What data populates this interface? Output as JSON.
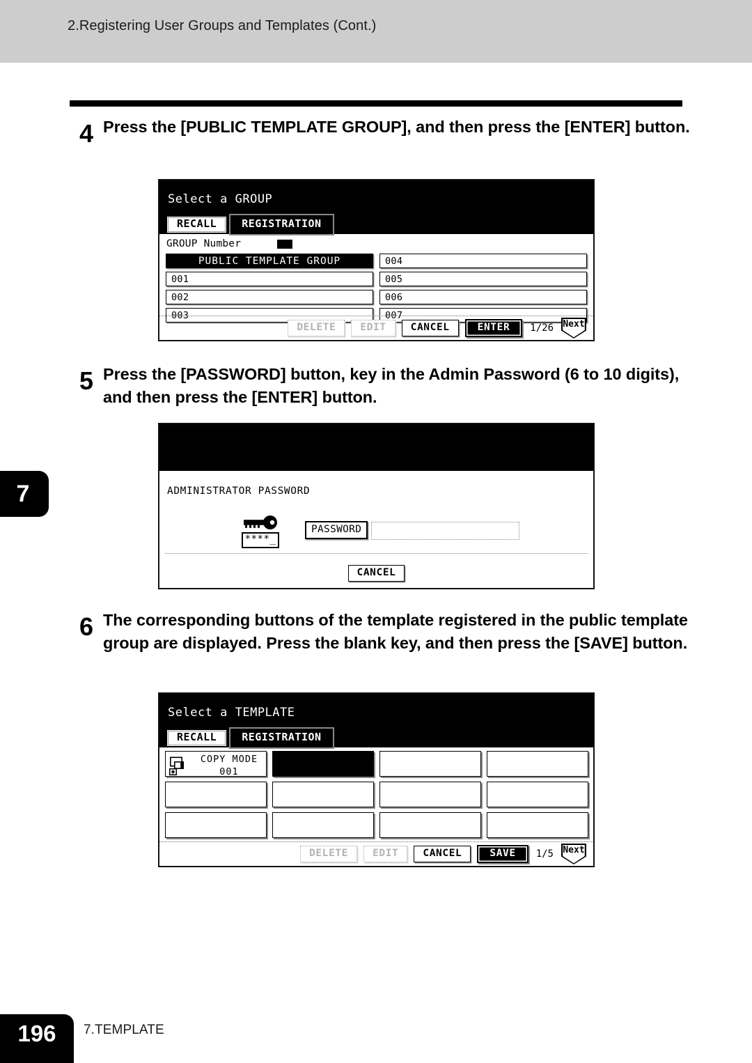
{
  "page": {
    "header_title": "2.Registering User Groups and Templates (Cont.)",
    "chapter_tab": "7",
    "page_number": "196",
    "footer_section": "7.TEMPLATE"
  },
  "steps": [
    {
      "number": "4",
      "text": "Press the [PUBLIC TEMPLATE GROUP], and then press the [ENTER] button."
    },
    {
      "number": "5",
      "text": "Press the [PASSWORD] button, key in the Admin Password (6 to 10 digits), and then press the [ENTER] button."
    },
    {
      "number": "6",
      "text": "The corresponding buttons of the template registered in the public template group are displayed. Press the blank key, and then press the [SAVE] button."
    }
  ],
  "panel_group": {
    "title": "Select a GROUP",
    "tabs": [
      {
        "label": "RECALL",
        "active": false
      },
      {
        "label": "REGISTRATION",
        "active": true
      }
    ],
    "group_number_label": "GROUP Number",
    "cells": [
      {
        "label": "PUBLIC TEMPLATE GROUP",
        "selected": true
      },
      {
        "label": "004",
        "selected": false
      },
      {
        "label": "001",
        "selected": false
      },
      {
        "label": "005",
        "selected": false
      },
      {
        "label": "002",
        "selected": false
      },
      {
        "label": "006",
        "selected": false
      },
      {
        "label": "003",
        "selected": false
      },
      {
        "label": "007",
        "selected": false
      }
    ],
    "footer": {
      "delete_label": "DELETE",
      "edit_label": "EDIT",
      "cancel_label": "CANCEL",
      "primary_label": "ENTER",
      "page_indicator": "1/26",
      "next_label": "Next"
    }
  },
  "panel_password": {
    "title": "",
    "admin_label": "ADMINISTRATOR PASSWORD",
    "key_icon": "key-icon",
    "masked_value": "****_",
    "password_button_label": "PASSWORD",
    "password_field_value": "",
    "cancel_label": "CANCEL"
  },
  "panel_template": {
    "title": "Select a TEMPLATE",
    "tabs": [
      {
        "label": "RECALL",
        "active": false
      },
      {
        "label": "REGISTRATION",
        "active": true
      }
    ],
    "cells": [
      {
        "icon": "copy-mode-icon",
        "line1": "COPY MODE",
        "line2": "001",
        "selected": false
      },
      {
        "icon": "",
        "line1": "",
        "line2": "",
        "selected": true
      },
      {
        "icon": "",
        "line1": "",
        "line2": "",
        "selected": false
      },
      {
        "icon": "",
        "line1": "",
        "line2": "",
        "selected": false
      },
      {
        "icon": "",
        "line1": "",
        "line2": "",
        "selected": false
      },
      {
        "icon": "",
        "line1": "",
        "line2": "",
        "selected": false
      },
      {
        "icon": "",
        "line1": "",
        "line2": "",
        "selected": false
      },
      {
        "icon": "",
        "line1": "",
        "line2": "",
        "selected": false
      },
      {
        "icon": "",
        "line1": "",
        "line2": "",
        "selected": false
      },
      {
        "icon": "",
        "line1": "",
        "line2": "",
        "selected": false
      },
      {
        "icon": "",
        "line1": "",
        "line2": "",
        "selected": false
      },
      {
        "icon": "",
        "line1": "",
        "line2": "",
        "selected": false
      }
    ],
    "footer": {
      "delete_label": "DELETE",
      "edit_label": "EDIT",
      "cancel_label": "CANCEL",
      "primary_label": "SAVE",
      "page_indicator": "1/5",
      "next_label": "Next"
    }
  },
  "colors": {
    "header_band": "#cdcdcd",
    "ink": "#000000",
    "paper": "#ffffff"
  }
}
